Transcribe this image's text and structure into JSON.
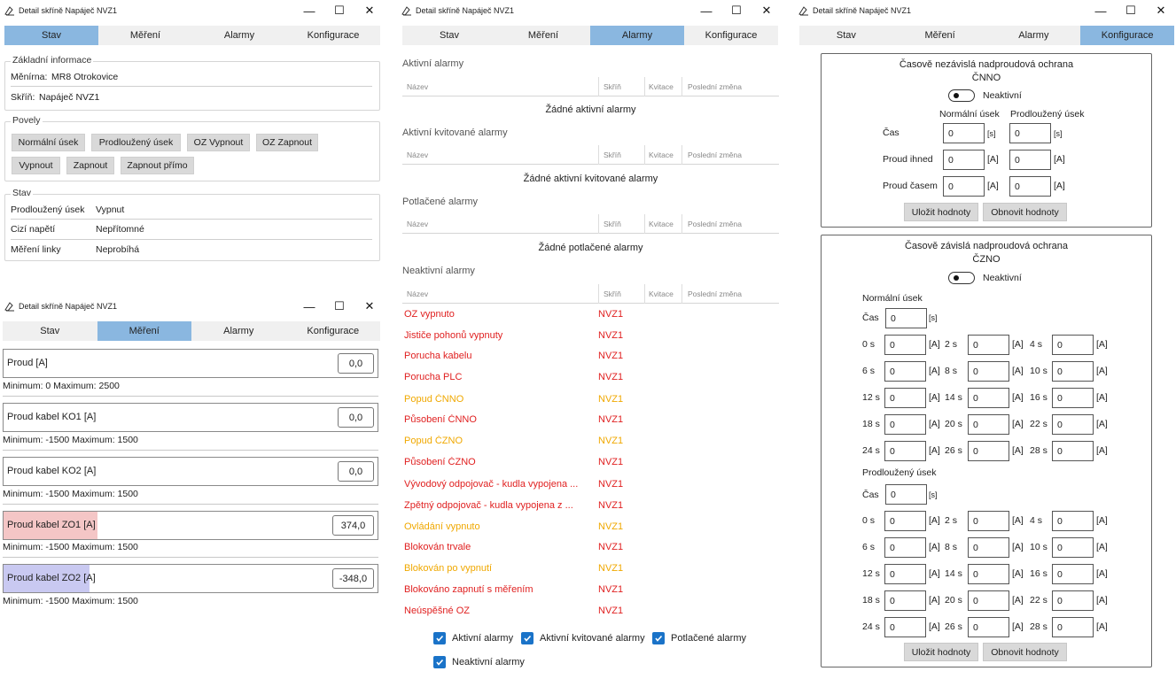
{
  "windows": {
    "stav": {
      "title": "Detail skříně Napáječ NVZ1"
    },
    "mereni": {
      "title": "Detail skříně Napáječ NVZ1"
    },
    "alarmy": {
      "title": "Detail skříně Napáječ NVZ1"
    },
    "konfigurace": {
      "title": "Detail skříně Napáječ NVZ1"
    }
  },
  "controls": {
    "minimize": "—",
    "maximize": "☐",
    "close": "✕"
  },
  "tabs": [
    "Stav",
    "Měření",
    "Alarmy",
    "Konfigurace"
  ],
  "stav": {
    "basic": {
      "legend": "Základní informace",
      "menirna_label": "Měnírna:",
      "menirna_value": "MR8 Otrokovice",
      "skrin_label": "Skříň:",
      "skrin_value": "Napáječ NVZ1"
    },
    "povely": {
      "legend": "Povely",
      "buttons": [
        "Normální úsek",
        "Prodloužený úsek",
        "OZ Vypnout",
        "OZ Zapnout",
        "Vypnout",
        "Zapnout",
        "Zapnout přímo"
      ]
    },
    "state": {
      "legend": "Stav",
      "rows": [
        {
          "label": "Prodloužený úsek",
          "value": "Vypnut"
        },
        {
          "label": "Cizí napětí",
          "value": "Nepřítomné"
        },
        {
          "label": "Měření linky",
          "value": "Neprobíhá"
        }
      ]
    }
  },
  "mereni": {
    "items": [
      {
        "label": "Proud [A]",
        "value": "0,0",
        "minmax": "Minimum: 0  Maximum: 2500"
      },
      {
        "label": "Proud kabel KO1 [A]",
        "value": "0,0",
        "minmax": "Minimum: -1500  Maximum: 1500"
      },
      {
        "label": "Proud kabel KO2 [A]",
        "value": "0,0",
        "minmax": "Minimum: -1500  Maximum: 1500"
      },
      {
        "label": "Proud kabel ZO1 [A]",
        "value": "374,0",
        "minmax": "Minimum: -1500  Maximum: 1500",
        "fill_fraction": 0.25,
        "fill_color": "#f4c6c6"
      },
      {
        "label": "Proud kabel ZO2 [A]",
        "value": "-348,0",
        "minmax": "Minimum: -1500  Maximum: 1500",
        "fill_fraction": 0.23,
        "fill_color": "#c9c9f1"
      }
    ]
  },
  "alarmy": {
    "headers": [
      "Název",
      "Skříň",
      "Kvitace",
      "Poslední změna"
    ],
    "sections": {
      "active": {
        "title": "Aktivní alarmy",
        "empty": "Žádné aktivní alarmy"
      },
      "acked": {
        "title": "Aktivní kvitované alarmy",
        "empty": "Žádné aktivní kvitované alarmy"
      },
      "suppressed": {
        "title": "Potlačené alarmy",
        "empty": "Žádné potlačené alarmy"
      },
      "inactive": {
        "title": "Neaktivní alarmy"
      }
    },
    "inactive_rows": [
      {
        "name": "OZ vypnuto",
        "cab": "NVZ1",
        "color": "#e02020"
      },
      {
        "name": "Jističe pohonů vypnuty",
        "cab": "NVZ1",
        "color": "#e02020"
      },
      {
        "name": "Porucha kabelu",
        "cab": "NVZ1",
        "color": "#e02020"
      },
      {
        "name": "Porucha PLC",
        "cab": "NVZ1",
        "color": "#e02020"
      },
      {
        "name": "Popud ČNNO",
        "cab": "NVZ1",
        "color": "#f0a800"
      },
      {
        "name": "Působení ČNNO",
        "cab": "NVZ1",
        "color": "#e02020"
      },
      {
        "name": "Popud ČZNO",
        "cab": "NVZ1",
        "color": "#f0a800"
      },
      {
        "name": "Působení ČZNO",
        "cab": "NVZ1",
        "color": "#e02020"
      },
      {
        "name": "Vývodový odpojovač - kudla vypojena ...",
        "cab": "NVZ1",
        "color": "#e02020"
      },
      {
        "name": "Zpětný odpojovač - kudla vypojena z ...",
        "cab": "NVZ1",
        "color": "#e02020"
      },
      {
        "name": "Ovládání vypnuto",
        "cab": "NVZ1",
        "color": "#f0a800"
      },
      {
        "name": "Blokován trvale",
        "cab": "NVZ1",
        "color": "#e02020"
      },
      {
        "name": "Blokován po vypnutí",
        "cab": "NVZ1",
        "color": "#f0a800"
      },
      {
        "name": "Blokováno zapnutí s měřením",
        "cab": "NVZ1",
        "color": "#e02020"
      },
      {
        "name": "Neúspěšné OZ",
        "cab": "NVZ1",
        "color": "#e02020"
      }
    ],
    "filters": [
      {
        "label": "Aktivní alarmy",
        "checked": true
      },
      {
        "label": "Aktivní kvitované alarmy",
        "checked": true
      },
      {
        "label": "Potlačené alarmy",
        "checked": true
      },
      {
        "label": "Neaktivní alarmy",
        "checked": true
      }
    ]
  },
  "konfigurace": {
    "cnno": {
      "title": "Časově nezávislá nadproudová ochrana",
      "subtitle": "ČNNO",
      "toggle_label": "Neaktivní",
      "col_normal": "Normální úsek",
      "col_extended": "Prodloužený úsek",
      "rows": [
        {
          "label": "Čas",
          "normal": "0",
          "extended": "0",
          "unit": "[s]"
        },
        {
          "label": "Proud ihned",
          "normal": "0",
          "extended": "0",
          "unit": "[A]"
        },
        {
          "label": "Proud časem",
          "normal": "0",
          "extended": "0",
          "unit": "[A]"
        }
      ],
      "save": "Uložit hodnoty",
      "reload": "Obnovit hodnoty"
    },
    "czno": {
      "title": "Časově závislá nadproudová ochrana",
      "subtitle": "ČZNO",
      "toggle_label": "Neaktivní",
      "normal_title": "Normální úsek",
      "extended_title": "Prodloužený úsek",
      "time_label": "Čas",
      "time_value": "0",
      "time_unit": "[s]",
      "current_unit": "[A]",
      "time_points": [
        "0 s",
        "2 s",
        "4 s",
        "6 s",
        "8 s",
        "10 s",
        "12 s",
        "14 s",
        "16 s",
        "18 s",
        "20 s",
        "22 s",
        "24 s",
        "26 s",
        "28 s"
      ],
      "normal_values": [
        "0",
        "0",
        "0",
        "0",
        "0",
        "0",
        "0",
        "0",
        "0",
        "0",
        "0",
        "0",
        "0",
        "0",
        "0"
      ],
      "extended_time_value": "0",
      "extended_values": [
        "0",
        "0",
        "0",
        "0",
        "0",
        "0",
        "0",
        "0",
        "0",
        "0",
        "0",
        "0",
        "0",
        "0",
        "0"
      ],
      "save": "Uložit hodnoty",
      "reload": "Obnovit hodnoty"
    }
  }
}
